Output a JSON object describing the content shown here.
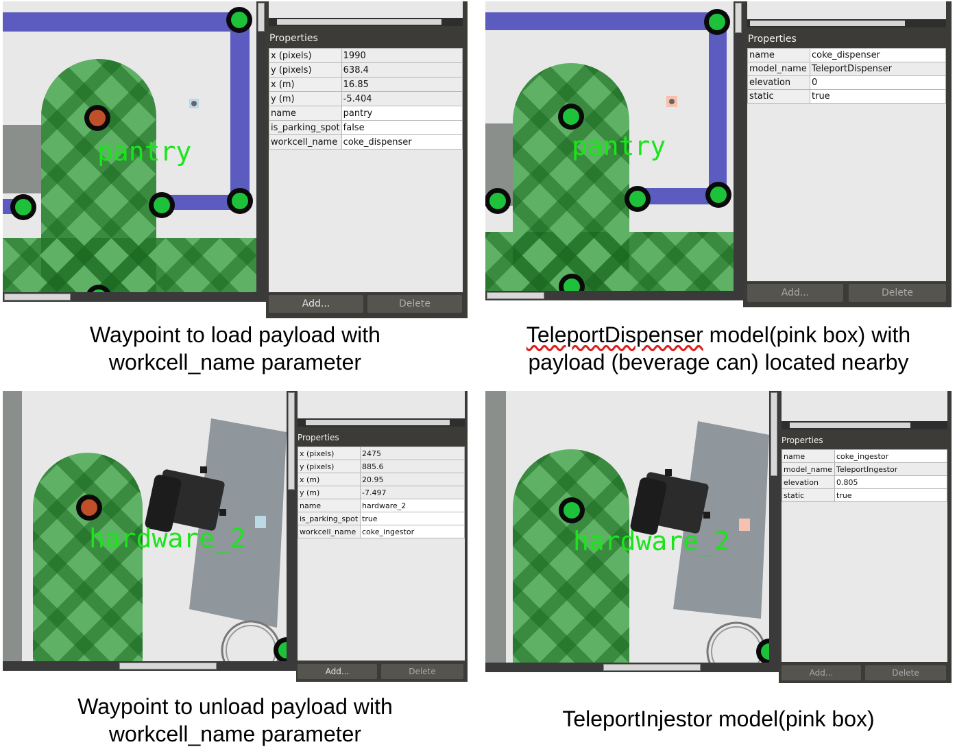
{
  "panels": [
    {
      "id": "load",
      "waypoint_label": "pantry",
      "properties_title": "Properties",
      "rows": [
        {
          "key": "x (pixels)",
          "value": "1990",
          "editable": false
        },
        {
          "key": "y (pixels)",
          "value": "638.4",
          "editable": false
        },
        {
          "key": "x (m)",
          "value": "16.85",
          "editable": false
        },
        {
          "key": "y (m)",
          "value": "-5.404",
          "editable": false
        },
        {
          "key": "name",
          "value": "pantry",
          "editable": true
        },
        {
          "key": "is_parking_spot",
          "value": "false",
          "editable": true
        },
        {
          "key": "workcell_name",
          "value": "coke_dispenser",
          "editable": true
        }
      ],
      "add_label": "Add...",
      "delete_label": "Delete",
      "caption_line1": "Waypoint to load payload with",
      "caption_line2": "workcell_name parameter"
    },
    {
      "id": "dispenser",
      "waypoint_label": "pantry",
      "properties_title": "Properties",
      "rows": [
        {
          "key": "name",
          "value": "coke_dispenser",
          "editable": true
        },
        {
          "key": "model_name",
          "value": "TeleportDispenser",
          "editable": false
        },
        {
          "key": "elevation",
          "value": "0",
          "editable": true
        },
        {
          "key": "static",
          "value": "true",
          "editable": true
        }
      ],
      "add_label": "Add...",
      "delete_label": "Delete",
      "caption_line1_underlined": "TeleportDispenser",
      "caption_line1_rest": " model(pink box) with",
      "caption_line2": "payload (beverage can) located nearby"
    },
    {
      "id": "unload",
      "waypoint_label": "hardware_2",
      "properties_title": "Properties",
      "rows": [
        {
          "key": "x (pixels)",
          "value": "2475",
          "editable": false
        },
        {
          "key": "y (pixels)",
          "value": "885.6",
          "editable": false
        },
        {
          "key": "x (m)",
          "value": "20.95",
          "editable": false
        },
        {
          "key": "y (m)",
          "value": "-7.497",
          "editable": false
        },
        {
          "key": "name",
          "value": "hardware_2",
          "editable": true
        },
        {
          "key": "is_parking_spot",
          "value": "true",
          "editable": true
        },
        {
          "key": "workcell_name",
          "value": "coke_ingestor",
          "editable": true
        }
      ],
      "add_label": "Add...",
      "delete_label": "Delete",
      "caption_line1": "Waypoint to unload payload with",
      "caption_line2": "workcell_name parameter"
    },
    {
      "id": "ingestor",
      "waypoint_label": "hardware_2",
      "properties_title": "Properties",
      "rows": [
        {
          "key": "name",
          "value": "coke_ingestor",
          "editable": true
        },
        {
          "key": "model_name",
          "value": "TeleportIngestor",
          "editable": false
        },
        {
          "key": "elevation",
          "value": "0.805",
          "editable": true
        },
        {
          "key": "static",
          "value": "true",
          "editable": true
        }
      ],
      "add_label": "Add...",
      "delete_label": "Delete",
      "caption_line1": "TeleportInjestor model(pink box)"
    }
  ],
  "colors": {
    "lane_blue": "#5b5bc0",
    "waypoint_green": "#1ec23a",
    "selected_waypoint": "#c0502a",
    "zone_green": "#2e9b3a",
    "label_green": "#19e51a",
    "teleport_box_pink": "#f7c1b0",
    "teleport_box_blue": "#bcd9e6",
    "panel_dark": "#3c3b37"
  }
}
